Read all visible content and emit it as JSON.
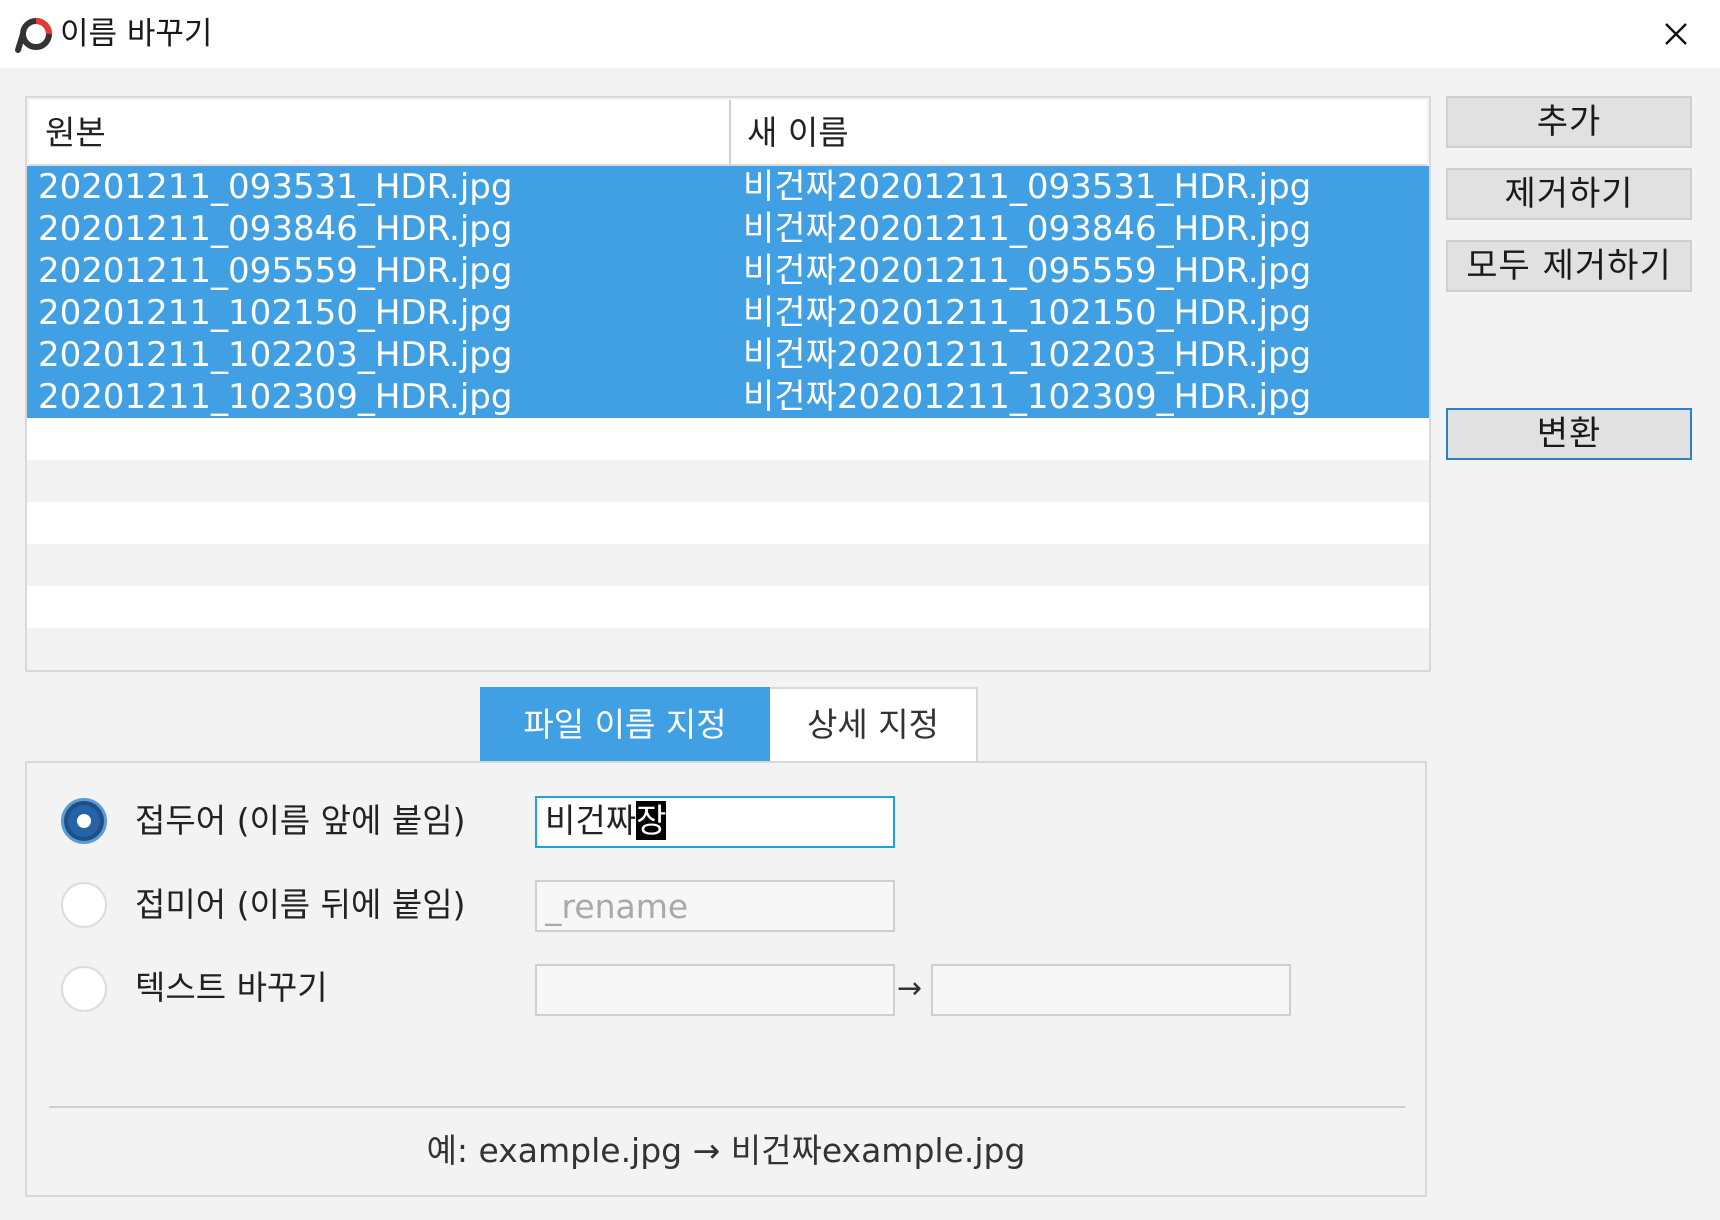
{
  "window": {
    "title": "이름 바꾸기",
    "close_icon": "close-icon"
  },
  "list": {
    "headers": {
      "original": "원본",
      "new_name": "새 이름"
    },
    "rows": [
      {
        "original": "20201211_093531_HDR.jpg",
        "new_name": "비건짜20201211_093531_HDR.jpg"
      },
      {
        "original": "20201211_093846_HDR.jpg",
        "new_name": "비건짜20201211_093846_HDR.jpg"
      },
      {
        "original": "20201211_095559_HDR.jpg",
        "new_name": "비건짜20201211_095559_HDR.jpg"
      },
      {
        "original": "20201211_102150_HDR.jpg",
        "new_name": "비건짜20201211_102150_HDR.jpg"
      },
      {
        "original": "20201211_102203_HDR.jpg",
        "new_name": "비건짜20201211_102203_HDR.jpg"
      },
      {
        "original": "20201211_102309_HDR.jpg",
        "new_name": "비건짜20201211_102309_HDR.jpg"
      }
    ]
  },
  "buttons": {
    "add": "추가",
    "remove": "제거하기",
    "remove_all": "모두 제거하기",
    "convert": "변환"
  },
  "tabs": {
    "filename": "파일 이름 지정",
    "advanced": "상세 지정"
  },
  "options": {
    "prefix_label": "접두어 (이름 앞에 붙임)",
    "prefix_value": "비건짜",
    "prefix_composing": "장",
    "suffix_label": "접미어 (이름 뒤에 붙임)",
    "suffix_placeholder": "_rename",
    "replace_label": "텍스트 바꾸기",
    "replace_arrow": "→",
    "selected": "prefix"
  },
  "example": "예: example.jpg → 비건짜example.jpg",
  "colors": {
    "selection": "#41a0e4",
    "focus_border": "#1ea4d8",
    "radio_checked": "#2563a6"
  }
}
